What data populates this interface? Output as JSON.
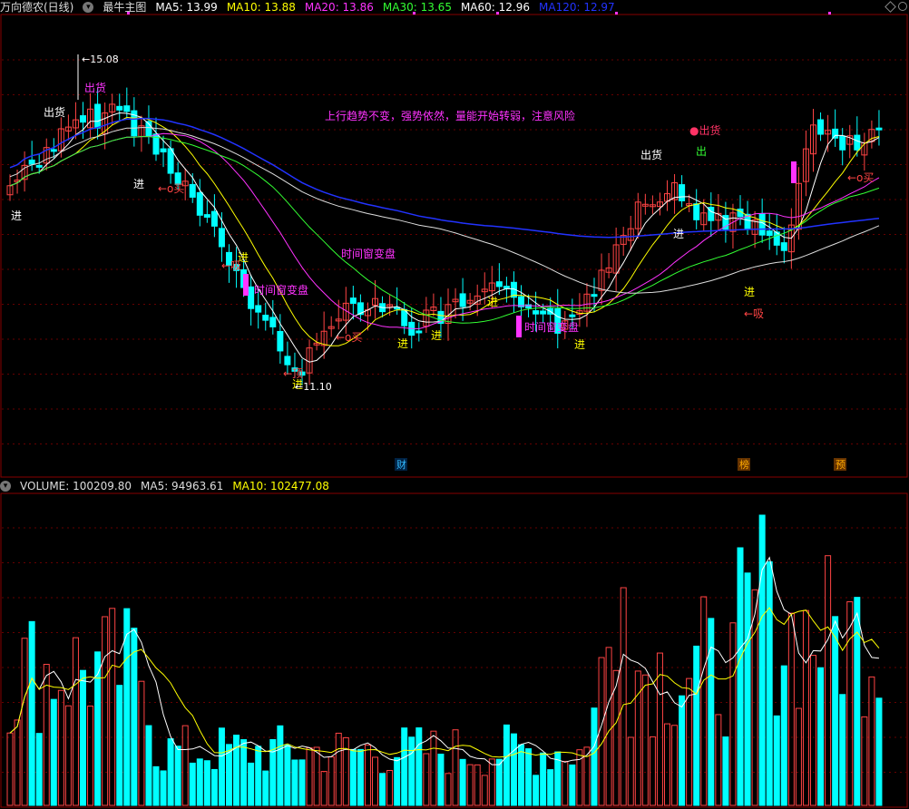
{
  "stock_title": "万向德农(日线)",
  "indicator_name": "最牛主图",
  "ma_price": [
    {
      "label": "MA5: 13.99",
      "color": "#ffffff"
    },
    {
      "label": "MA10: 13.88",
      "color": "#ffff00"
    },
    {
      "label": "MA20: 13.86",
      "color": "#ff33ff"
    },
    {
      "label": "MA30: 13.65",
      "color": "#33ff33"
    },
    {
      "label": "MA60: 12.96",
      "color": "#ffffff"
    },
    {
      "label": "MA120: 12.97",
      "color": "#2233ff"
    }
  ],
  "volume_header": [
    {
      "label": "VOLUME: 100209.80",
      "color": "#dddddd"
    },
    {
      "label": "MA5: 94963.61",
      "color": "#dddddd"
    },
    {
      "label": "MA10: 102477.08",
      "color": "#ffff00"
    }
  ],
  "colors": {
    "up": "#ff4444",
    "down": "#00ffff",
    "grid": "#660000",
    "magenta": "#ff33ff"
  },
  "price_labels": {
    "high": "15.08",
    "low": "11.10"
  },
  "annotations": [
    {
      "text": "上行趋势不变，强势依然，量能开始转弱，注意风险",
      "color": "#ff33ff",
      "kind": "note"
    },
    {
      "text": "出货",
      "color": "#ff33ff",
      "kind": "sell"
    },
    {
      "text": "出货",
      "color": "#ffffff",
      "kind": "sell"
    },
    {
      "text": "出货",
      "color": "#ffffff",
      "kind": "sell"
    },
    {
      "text": "●出货",
      "color": "#ff3366",
      "kind": "sell"
    },
    {
      "text": "进",
      "color": "#ffffff",
      "kind": "buy"
    },
    {
      "text": "进",
      "color": "#ffffff",
      "kind": "buy"
    },
    {
      "text": "进",
      "color": "#ffff00",
      "kind": "buy"
    },
    {
      "text": "进",
      "color": "#ffff00",
      "kind": "buy"
    },
    {
      "text": "进",
      "color": "#ffff00",
      "kind": "buy"
    },
    {
      "text": "进",
      "color": "#ffff00",
      "kind": "buy"
    },
    {
      "text": "进",
      "color": "#ffff00",
      "kind": "buy"
    },
    {
      "text": "进",
      "color": "#ffff00",
      "kind": "buy"
    },
    {
      "text": "进",
      "color": "#ffffff",
      "kind": "buy"
    },
    {
      "text": "进",
      "color": "#ffff00",
      "kind": "buy"
    },
    {
      "text": "←o买",
      "color": "#ff4444",
      "kind": "buy"
    },
    {
      "text": "←o买",
      "color": "#ff4444",
      "kind": "buy"
    },
    {
      "text": "←o买",
      "color": "#ff4444",
      "kind": "buy"
    },
    {
      "text": "←吸",
      "color": "#ff4444",
      "kind": "buy"
    },
    {
      "text": "←吸",
      "color": "#ff4444",
      "kind": "buy"
    },
    {
      "text": "←顶",
      "color": "#ff4444",
      "kind": "sell"
    },
    {
      "text": "出",
      "color": "#33ff33",
      "kind": "sell"
    },
    {
      "text": "时间窗变盘",
      "color": "#ff33ff",
      "kind": "note"
    },
    {
      "text": "时间窗变盘",
      "color": "#ff33ff",
      "kind": "note"
    },
    {
      "text": "时间窗变盘",
      "color": "#ff33ff",
      "kind": "note"
    }
  ],
  "bottom_markers": [
    {
      "text": "财",
      "color": "#33bbff"
    },
    {
      "text": "榜",
      "color": "#ffaa00"
    },
    {
      "text": "预",
      "color": "#ffaa00"
    }
  ]
}
